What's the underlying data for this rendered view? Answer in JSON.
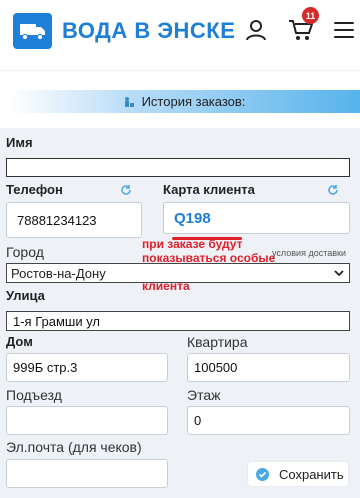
{
  "header": {
    "brand": "ВОДА В ЭНСКЕ",
    "cart_count": "11",
    "icons": [
      "truck-icon",
      "user-icon",
      "cart-icon",
      "menu-icon"
    ],
    "brand_color": "#1e7fd8",
    "badge_color": "#d62b2b"
  },
  "history": {
    "label": "История заказов:"
  },
  "form": {
    "name_label": "Имя",
    "name_value": "",
    "phone_label": "Телефон",
    "phone_value": "78881234123",
    "card_label": "Карта клиента",
    "card_value": "Q198",
    "card_note": "при заказе будут показываться особые цены по карте клиента",
    "city_label": "Город",
    "delivery_link": "условия доставки",
    "city_value": "Ростов-на-Дону",
    "street_label": "Улица",
    "street_value": "1-я Грамши ул",
    "house_label": "Дом",
    "house_value": "999Б стр.3",
    "apt_label": "Квартира",
    "apt_value": "100500",
    "entrance_label": "Подъезд",
    "entrance_value": "",
    "floor_label": "Этаж",
    "floor_value": "0",
    "email_label": "Эл.почта (для чеков)",
    "email_value": "",
    "save_label": "Сохранить"
  },
  "colors": {
    "note": "#e0202a",
    "accent": "#1e7fd8"
  }
}
